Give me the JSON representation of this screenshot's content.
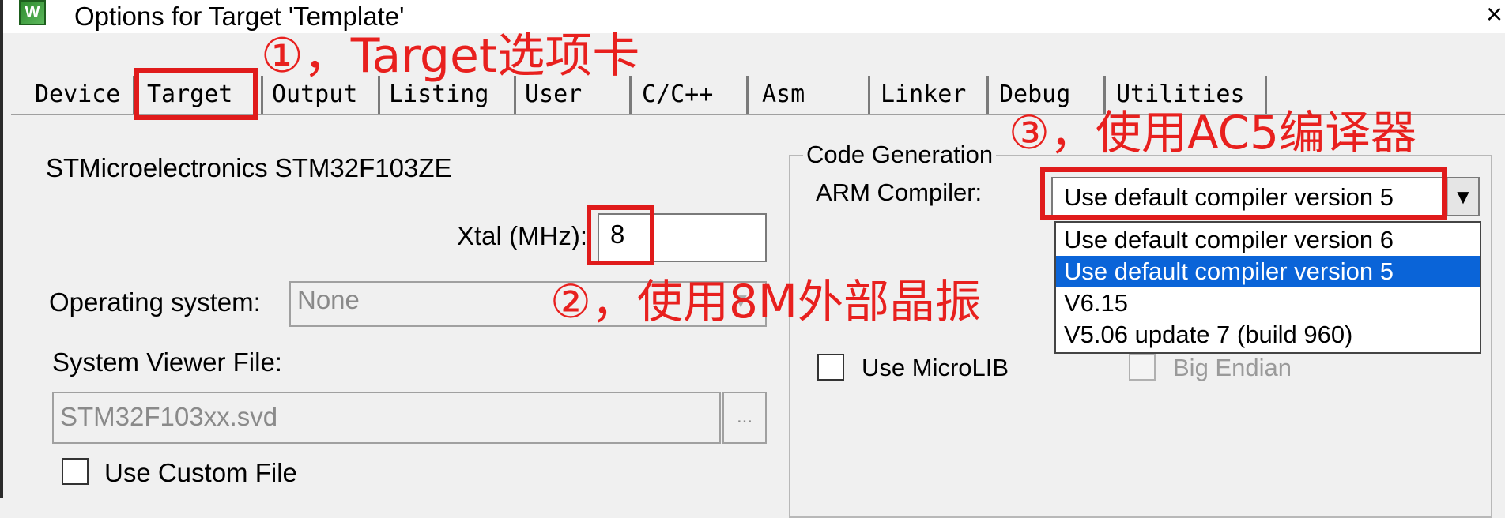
{
  "window": {
    "title": "Options for Target 'Template'",
    "icon": "uvision-icon",
    "close_glyph": "×"
  },
  "tabs": [
    {
      "label": "Device"
    },
    {
      "label": "Target",
      "active": true
    },
    {
      "label": "Output"
    },
    {
      "label": "Listing"
    },
    {
      "label": "User"
    },
    {
      "label": "C/C++"
    },
    {
      "label": "Asm"
    },
    {
      "label": "Linker"
    },
    {
      "label": "Debug"
    },
    {
      "label": "Utilities"
    }
  ],
  "target": {
    "device_name": "STMicroelectronics STM32F103ZE",
    "xtal_label": "Xtal (MHz):",
    "xtal_value": "8",
    "os_label": "Operating system:",
    "os_value": "None",
    "svd_label": "System Viewer File:",
    "svd_value": "STM32F103xx.svd",
    "browse_label": "...",
    "use_custom_file_label": "Use Custom File"
  },
  "code_generation": {
    "group_title": "Code Generation",
    "arm_compiler_label": "ARM Compiler:",
    "arm_compiler_value": "Use default compiler version 5",
    "options": [
      "Use default compiler version 6",
      "Use default compiler version 5",
      "V6.15",
      "V5.06 update 7 (build 960)"
    ],
    "selected_index": 1,
    "use_microlib_label": "Use MicroLIB",
    "big_endian_label": "Big Endian"
  },
  "annotations": {
    "note1": "①，Target选项卡",
    "note2": "②，使用8M外部晶振",
    "note3": "③，使用AC5编译器",
    "color": "#e8201e"
  }
}
